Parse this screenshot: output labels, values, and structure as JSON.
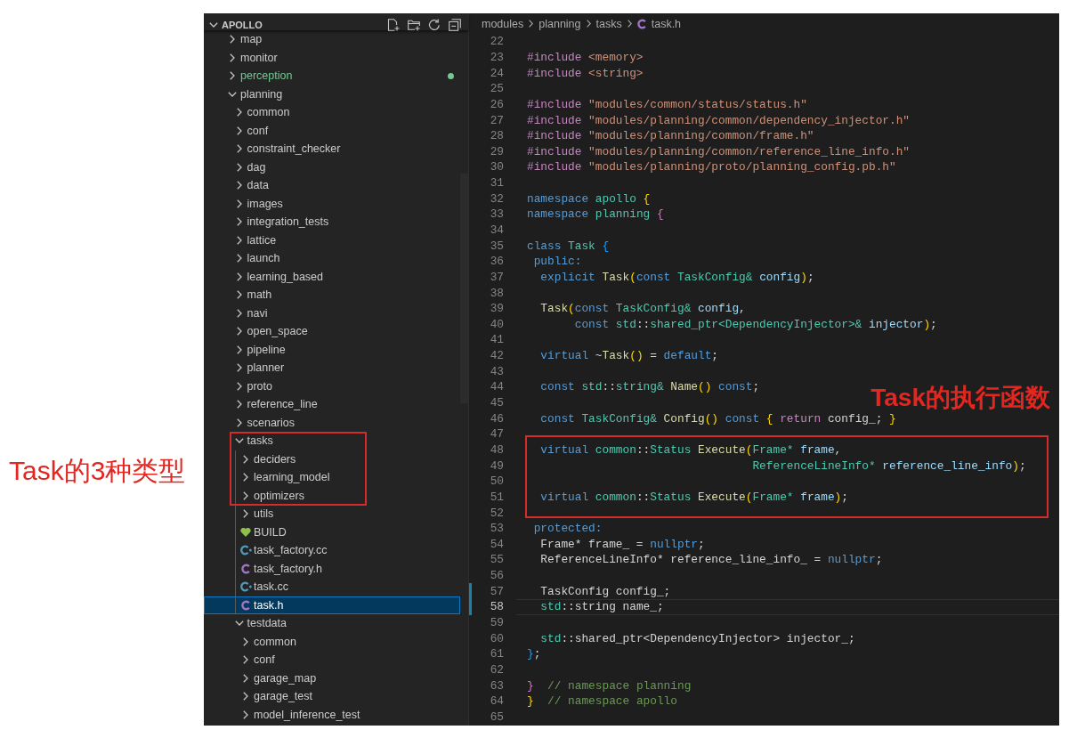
{
  "annotations": [
    {
      "text": "Task的3种类型"
    },
    {
      "text": "Task的执行函数"
    }
  ],
  "explorer": {
    "title": "APOLLO",
    "expanded": true,
    "tree": [
      {
        "label": "map",
        "kind": "folder",
        "expanded": false,
        "selected": false
      },
      {
        "label": "monitor",
        "kind": "folder",
        "expanded": false,
        "selected": false
      },
      {
        "label": "perception",
        "kind": "folder",
        "expanded": false,
        "selected": false,
        "color": "#73c991"
      },
      {
        "label": "planning",
        "kind": "folder",
        "expanded": true,
        "selected": false,
        "children": [
          {
            "label": "common",
            "kind": "folder",
            "expanded": false,
            "selected": false
          },
          {
            "label": "conf",
            "kind": "folder",
            "expanded": false,
            "selected": false
          },
          {
            "label": "constraint_checker",
            "kind": "folder",
            "expanded": false,
            "selected": false
          },
          {
            "label": "dag",
            "kind": "folder",
            "expanded": false,
            "selected": false
          },
          {
            "label": "data",
            "kind": "folder",
            "expanded": false,
            "selected": false
          },
          {
            "label": "images",
            "kind": "folder",
            "expanded": false,
            "selected": false
          },
          {
            "label": "integration_tests",
            "kind": "folder",
            "expanded": false,
            "selected": false
          },
          {
            "label": "lattice",
            "kind": "folder",
            "expanded": false,
            "selected": false
          },
          {
            "label": "launch",
            "kind": "folder",
            "expanded": false,
            "selected": false
          },
          {
            "label": "learning_based",
            "kind": "folder",
            "expanded": false,
            "selected": false
          },
          {
            "label": "math",
            "kind": "folder",
            "expanded": false,
            "selected": false
          },
          {
            "label": "navi",
            "kind": "folder",
            "expanded": false,
            "selected": false
          },
          {
            "label": "open_space",
            "kind": "folder",
            "expanded": false,
            "selected": false
          },
          {
            "label": "pipeline",
            "kind": "folder",
            "expanded": false,
            "selected": false
          },
          {
            "label": "planner",
            "kind": "folder",
            "expanded": false,
            "selected": false
          },
          {
            "label": "proto",
            "kind": "folder",
            "expanded": false,
            "selected": false
          },
          {
            "label": "reference_line",
            "kind": "folder",
            "expanded": false,
            "selected": false
          },
          {
            "label": "scenarios",
            "kind": "folder",
            "expanded": false,
            "selected": false
          },
          {
            "label": "tasks",
            "kind": "folder",
            "expanded": true,
            "selected": false,
            "children": [
              {
                "label": "deciders",
                "kind": "folder",
                "expanded": false,
                "selected": false
              },
              {
                "label": "learning_model",
                "kind": "folder",
                "expanded": false,
                "selected": false
              },
              {
                "label": "optimizers",
                "kind": "folder",
                "expanded": false,
                "selected": false
              },
              {
                "label": "utils",
                "kind": "folder",
                "expanded": false,
                "selected": false
              },
              {
                "label": "BUILD",
                "kind": "build",
                "selected": false
              },
              {
                "label": "task_factory.cc",
                "kind": "source",
                "selected": false
              },
              {
                "label": "task_factory.h",
                "kind": "header",
                "selected": false
              },
              {
                "label": "task.cc",
                "kind": "source",
                "selected": false
              },
              {
                "label": "task.h",
                "kind": "header",
                "selected": true
              }
            ]
          },
          {
            "label": "testdata",
            "kind": "folder",
            "expanded": true,
            "selected": false,
            "children": [
              {
                "label": "common",
                "kind": "folder",
                "expanded": false,
                "selected": false
              },
              {
                "label": "conf",
                "kind": "folder",
                "expanded": false,
                "selected": false
              },
              {
                "label": "garage_map",
                "kind": "folder",
                "expanded": false,
                "selected": false
              },
              {
                "label": "garage_test",
                "kind": "folder",
                "expanded": false,
                "selected": false
              },
              {
                "label": "model_inference_test",
                "kind": "folder",
                "expanded": false,
                "selected": false
              }
            ]
          }
        ]
      }
    ]
  },
  "editor": {
    "breadcrumb": [
      {
        "label": "modules",
        "kind": "folder"
      },
      {
        "label": "planning",
        "kind": "folder"
      },
      {
        "label": "tasks",
        "kind": "folder"
      },
      {
        "label": "task.h",
        "kind": "header"
      }
    ],
    "lines": [
      {
        "number": "22",
        "current": false,
        "modified": false
      },
      {
        "number": "23",
        "current": false,
        "modified": false,
        "tokens": [
          {
            "text": "#include",
            "kind": "directive"
          },
          {
            "text": " <memory>",
            "kind": "string"
          }
        ]
      },
      {
        "number": "24",
        "current": false,
        "modified": false,
        "tokens": [
          {
            "text": "#include",
            "kind": "directive"
          },
          {
            "text": " <string>",
            "kind": "string"
          }
        ]
      },
      {
        "number": "25",
        "current": false,
        "modified": false
      },
      {
        "number": "26",
        "current": false,
        "modified": false,
        "tokens": [
          {
            "text": "#include",
            "kind": "directive"
          },
          {
            "text": " \"modules/common/status/status.h\"",
            "kind": "string"
          }
        ]
      },
      {
        "number": "27",
        "current": false,
        "modified": false,
        "tokens": [
          {
            "text": "#include",
            "kind": "directive"
          },
          {
            "text": " \"modules/planning/common/dependency_injector.h\"",
            "kind": "string"
          }
        ]
      },
      {
        "number": "28",
        "current": false,
        "modified": false,
        "tokens": [
          {
            "text": "#include",
            "kind": "directive"
          },
          {
            "text": " \"modules/planning/common/frame.h\"",
            "kind": "string"
          }
        ]
      },
      {
        "number": "29",
        "current": false,
        "modified": false,
        "tokens": [
          {
            "text": "#include",
            "kind": "directive"
          },
          {
            "text": " \"modules/planning/common/reference_line_info.h\"",
            "kind": "string"
          }
        ]
      },
      {
        "number": "30",
        "current": false,
        "modified": false,
        "tokens": [
          {
            "text": "#include",
            "kind": "directive"
          },
          {
            "text": " \"modules/planning/proto/planning_config.pb.h\"",
            "kind": "string"
          }
        ]
      },
      {
        "number": "31",
        "current": false,
        "modified": false
      },
      {
        "number": "32",
        "current": false,
        "modified": false,
        "tokens": [
          {
            "text": "namespace",
            "kind": "keyword"
          },
          {
            "text": " apollo",
            "kind": "type"
          },
          {
            "text": " {",
            "kind": "bracket1"
          }
        ]
      },
      {
        "number": "33",
        "current": false,
        "modified": false,
        "tokens": [
          {
            "text": "namespace",
            "kind": "keyword"
          },
          {
            "text": " planning",
            "kind": "type"
          },
          {
            "text": " {",
            "kind": "bracket2"
          }
        ]
      },
      {
        "number": "34",
        "current": false,
        "modified": false
      },
      {
        "number": "35",
        "current": false,
        "modified": false,
        "tokens": [
          {
            "text": "class",
            "kind": "keyword"
          },
          {
            "text": " Task",
            "kind": "type"
          },
          {
            "text": " {",
            "kind": "bracket3"
          }
        ]
      },
      {
        "number": "36",
        "current": false,
        "modified": false,
        "tokens": [
          {
            "text": " public:",
            "kind": "keyword"
          }
        ]
      },
      {
        "number": "37",
        "current": false,
        "modified": false,
        "tokens": [
          {
            "text": "  explicit",
            "kind": "keyword"
          },
          {
            "text": " Task",
            "kind": "function"
          },
          {
            "text": "(",
            "kind": "bracket1"
          },
          {
            "text": "const",
            "kind": "keyword"
          },
          {
            "text": " TaskConfig&",
            "kind": "type"
          },
          {
            "text": " config",
            "kind": "variable"
          },
          {
            "text": ")",
            "kind": "bracket1"
          },
          {
            "text": ";",
            "kind": "plain"
          }
        ]
      },
      {
        "number": "38",
        "current": false,
        "modified": false
      },
      {
        "number": "39",
        "current": false,
        "modified": false,
        "tokens": [
          {
            "text": "  Task",
            "kind": "function"
          },
          {
            "text": "(",
            "kind": "bracket1"
          },
          {
            "text": "const",
            "kind": "keyword"
          },
          {
            "text": " TaskConfig&",
            "kind": "type"
          },
          {
            "text": " config",
            "kind": "variable"
          },
          {
            "text": ",",
            "kind": "plain"
          }
        ]
      },
      {
        "number": "40",
        "current": false,
        "modified": false,
        "tokens": [
          {
            "text": "       const",
            "kind": "keyword"
          },
          {
            "text": " std",
            "kind": "type"
          },
          {
            "text": "::",
            "kind": "plain"
          },
          {
            "text": "shared_ptr<DependencyInjector>&",
            "kind": "type"
          },
          {
            "text": " injector",
            "kind": "variable"
          },
          {
            "text": ")",
            "kind": "bracket1"
          },
          {
            "text": ";",
            "kind": "plain"
          }
        ]
      },
      {
        "number": "41",
        "current": false,
        "modified": false
      },
      {
        "number": "42",
        "current": false,
        "modified": false,
        "tokens": [
          {
            "text": "  virtual",
            "kind": "keyword"
          },
          {
            "text": " ~",
            "kind": "plain"
          },
          {
            "text": "Task",
            "kind": "function"
          },
          {
            "text": "()",
            "kind": "bracket1"
          },
          {
            "text": " =",
            "kind": "plain"
          },
          {
            "text": " default",
            "kind": "keyword"
          },
          {
            "text": ";",
            "kind": "plain"
          }
        ]
      },
      {
        "number": "43",
        "current": false,
        "modified": false
      },
      {
        "number": "44",
        "current": false,
        "modified": false,
        "tokens": [
          {
            "text": "  const",
            "kind": "keyword"
          },
          {
            "text": " std",
            "kind": "type"
          },
          {
            "text": "::",
            "kind": "plain"
          },
          {
            "text": "string&",
            "kind": "type"
          },
          {
            "text": " Name",
            "kind": "function"
          },
          {
            "text": "()",
            "kind": "bracket1"
          },
          {
            "text": " const",
            "kind": "keyword"
          },
          {
            "text": ";",
            "kind": "plain"
          }
        ]
      },
      {
        "number": "45",
        "current": false,
        "modified": false
      },
      {
        "number": "46",
        "current": false,
        "modified": false,
        "tokens": [
          {
            "text": "  const",
            "kind": "keyword"
          },
          {
            "text": " TaskConfig&",
            "kind": "type"
          },
          {
            "text": " Config",
            "kind": "function"
          },
          {
            "text": "()",
            "kind": "bracket1"
          },
          {
            "text": " const",
            "kind": "keyword"
          },
          {
            "text": " {",
            "kind": "bracket1"
          },
          {
            "text": " return",
            "kind": "control"
          },
          {
            "text": " config_;",
            "kind": "plain"
          },
          {
            "text": " }",
            "kind": "bracket1"
          }
        ]
      },
      {
        "number": "47",
        "current": false,
        "modified": false
      },
      {
        "number": "48",
        "current": false,
        "modified": false,
        "tokens": [
          {
            "text": "  virtual",
            "kind": "keyword"
          },
          {
            "text": " common",
            "kind": "type"
          },
          {
            "text": "::",
            "kind": "plain"
          },
          {
            "text": "Status",
            "kind": "type"
          },
          {
            "text": " Execute",
            "kind": "function"
          },
          {
            "text": "(",
            "kind": "bracket1"
          },
          {
            "text": "Frame*",
            "kind": "type"
          },
          {
            "text": " frame",
            "kind": "variable"
          },
          {
            "text": ",",
            "kind": "plain"
          }
        ]
      },
      {
        "number": "49",
        "current": false,
        "modified": false,
        "tokens": [
          {
            "text": "                                 ReferenceLineInfo*",
            "kind": "type"
          },
          {
            "text": " reference_line_info",
            "kind": "variable"
          },
          {
            "text": ")",
            "kind": "bracket1"
          },
          {
            "text": ";",
            "kind": "plain"
          }
        ]
      },
      {
        "number": "50",
        "current": false,
        "modified": false
      },
      {
        "number": "51",
        "current": false,
        "modified": false,
        "tokens": [
          {
            "text": "  virtual",
            "kind": "keyword"
          },
          {
            "text": " common",
            "kind": "type"
          },
          {
            "text": "::",
            "kind": "plain"
          },
          {
            "text": "Status",
            "kind": "type"
          },
          {
            "text": " Execute",
            "kind": "function"
          },
          {
            "text": "(",
            "kind": "bracket1"
          },
          {
            "text": "Frame*",
            "kind": "type"
          },
          {
            "text": " frame",
            "kind": "variable"
          },
          {
            "text": ")",
            "kind": "bracket1"
          },
          {
            "text": ";",
            "kind": "plain"
          }
        ]
      },
      {
        "number": "52",
        "current": false,
        "modified": false
      },
      {
        "number": "53",
        "current": false,
        "modified": false,
        "tokens": [
          {
            "text": " protected:",
            "kind": "keyword"
          }
        ]
      },
      {
        "number": "54",
        "current": false,
        "modified": false,
        "tokens": [
          {
            "text": "  Frame* frame_ =",
            "kind": "plain"
          },
          {
            "text": " nullptr",
            "kind": "keyword"
          },
          {
            "text": ";",
            "kind": "plain"
          }
        ]
      },
      {
        "number": "55",
        "current": false,
        "modified": false,
        "tokens": [
          {
            "text": "  ReferenceLineInfo* reference_line_info_ =",
            "kind": "plain"
          },
          {
            "text": " nullptr",
            "kind": "keyword"
          },
          {
            "text": ";",
            "kind": "plain"
          }
        ]
      },
      {
        "number": "56",
        "current": false,
        "modified": false
      },
      {
        "number": "57",
        "current": false,
        "modified": true,
        "tokens": [
          {
            "text": "  TaskConfig config_;",
            "kind": "plain"
          }
        ]
      },
      {
        "number": "58",
        "current": true,
        "modified": true,
        "tokens": [
          {
            "text": "  std",
            "kind": "type"
          },
          {
            "text": "::string name_;",
            "kind": "plain"
          }
        ]
      },
      {
        "number": "59",
        "current": false,
        "modified": false
      },
      {
        "number": "60",
        "current": false,
        "modified": false,
        "tokens": [
          {
            "text": "  std",
            "kind": "type"
          },
          {
            "text": "::shared_ptr<DependencyInjector> injector_;",
            "kind": "plain"
          }
        ]
      },
      {
        "number": "61",
        "current": false,
        "modified": false,
        "tokens": [
          {
            "text": "}",
            "kind": "bracket3"
          },
          {
            "text": ";",
            "kind": "plain"
          }
        ]
      },
      {
        "number": "62",
        "current": false,
        "modified": false
      },
      {
        "number": "63",
        "current": false,
        "modified": false,
        "tokens": [
          {
            "text": "}",
            "kind": "bracket2"
          },
          {
            "text": "  // namespace planning",
            "kind": "comment"
          }
        ]
      },
      {
        "number": "64",
        "current": false,
        "modified": false,
        "tokens": [
          {
            "text": "}",
            "kind": "bracket1"
          },
          {
            "text": "  // namespace apollo",
            "kind": "comment"
          }
        ]
      },
      {
        "number": "65",
        "current": false,
        "modified": false
      }
    ]
  }
}
